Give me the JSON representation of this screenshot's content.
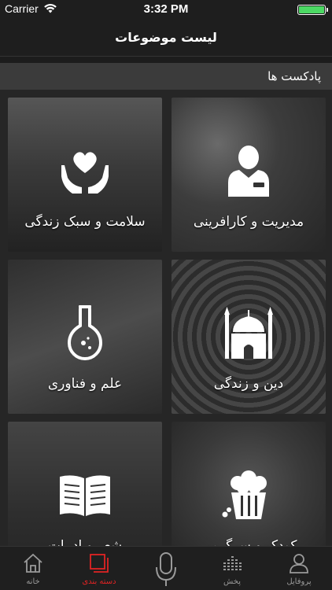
{
  "status_bar": {
    "carrier": "Carrier",
    "time": "3:32 PM",
    "battery_level": 1.0
  },
  "nav": {
    "title": "لیست موضوعات"
  },
  "section": {
    "title": "پادکست ها"
  },
  "tiles": [
    {
      "label": "مدیریت و کارافرینی",
      "icon": "businessman-icon"
    },
    {
      "label": "سلامت و سبک زندگی",
      "icon": "heart-hands-icon"
    },
    {
      "label": "دین و زندگی",
      "icon": "mosque-icon"
    },
    {
      "label": "علم و فناوری",
      "icon": "flask-icon"
    },
    {
      "label": "کودک و سرگرمی",
      "icon": "popcorn-icon"
    },
    {
      "label": "شعر و ادبیات",
      "icon": "book-icon"
    }
  ],
  "tab_bar": {
    "items": [
      {
        "label": "خانه",
        "icon": "home-icon"
      },
      {
        "label": "دسته بندی",
        "icon": "categories-icon",
        "active": true
      },
      {
        "label": "",
        "icon": "microphone-icon"
      },
      {
        "label": "پخش",
        "icon": "equalizer-icon"
      },
      {
        "label": "پروفایل",
        "icon": "profile-icon"
      }
    ]
  },
  "colors": {
    "active": "#e02424",
    "inactive": "#9a9a9a",
    "section_bg": "#3b3b3b"
  }
}
